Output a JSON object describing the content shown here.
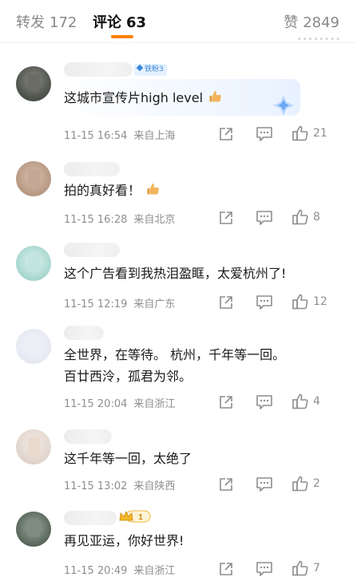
{
  "tabs": {
    "repost": {
      "label": "转发",
      "count": "172"
    },
    "comments": {
      "label": "评论",
      "count": "63"
    },
    "likes": {
      "label": "赞",
      "count": "2849"
    }
  },
  "header_faint_text": "••••••••",
  "badges": {
    "fan": "铁粉3",
    "vip_level": "1"
  },
  "comments": [
    {
      "text": "这城市宣传片high level",
      "emoji": "thumbs-up",
      "time": "11-15 16:54",
      "location": "来自上海",
      "likes": "21"
    },
    {
      "text": "拍的真好看！",
      "emoji": "thumbs-up",
      "time": "11-15 16:28",
      "location": "来自北京",
      "likes": "8"
    },
    {
      "text": "这个广告看到我热泪盈眶，太爱杭州了!",
      "time": "11-15 12:19",
      "location": "来自广东",
      "likes": "12"
    },
    {
      "text_line1": "全世界，在等待。 杭州，千年等一回。",
      "text_line2": "百廿西泠，孤君为邻。",
      "time": "11-15 20:04",
      "location": "来自浙江",
      "likes": "4"
    },
    {
      "text": "这千年等一回，太绝了",
      "time": "11-15 13:02",
      "location": "来自陕西",
      "likes": "2"
    },
    {
      "text": "再见亚运，你好世界!",
      "time": "11-15 20:49",
      "location": "来自浙江",
      "likes": "7"
    }
  ],
  "colors": {
    "accent": "#ff8200",
    "meta_gray": "#8e8e8e",
    "fan_badge_blue": "#3a86d8"
  },
  "icons": [
    "share-icon",
    "comment-icon",
    "like-icon",
    "thumbs-up-emoji",
    "sparkle-icon",
    "crown-icon"
  ]
}
